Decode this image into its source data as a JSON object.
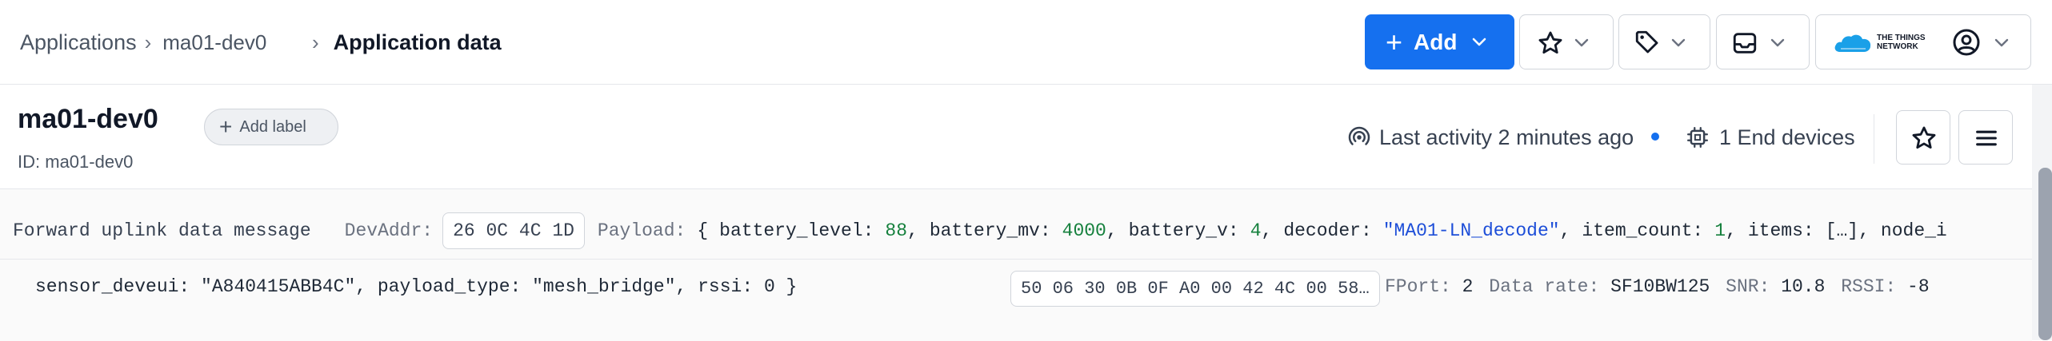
{
  "breadcrumb": {
    "root": "Applications",
    "app": "ma01-dev0",
    "current": "Application data"
  },
  "header": {
    "add_label": "Add",
    "brand_line1": "THE THINGS",
    "brand_line2": "NETWORK"
  },
  "app": {
    "name": "ma01-dev0",
    "id_label": "ID:",
    "id": "ma01-dev0",
    "add_label": "Add label",
    "last_activity": "Last activity 2 minutes ago",
    "end_devices": "1 End devices"
  },
  "event": {
    "type": "Forward uplink data message",
    "devaddr_key": "DevAddr:",
    "devaddr": "26 0C 4C 1D",
    "payload_key": "Payload:",
    "payload_open": "{",
    "battery_level_key": "battery_level:",
    "battery_level": "88",
    "battery_mv_key": "battery_mv:",
    "battery_mv": "4000",
    "battery_v_key": "battery_v:",
    "battery_v": "4",
    "decoder_key": "decoder:",
    "decoder": "\"MA01-LN_decode\"",
    "item_count_key": "item_count:",
    "item_count": "1",
    "items_key": "items:",
    "items": "[…]",
    "node_key": "node_i",
    "continuation": "sensor_deveui: \"A840415ABB4C\", payload_type: \"mesh_bridge\", rssi: 0 }",
    "raw_payload": "50 06 30 0B 0F A0 00 42 4C 00 58…",
    "fport_key": "FPort:",
    "fport": "2",
    "datarate_key": "Data rate:",
    "datarate": "SF10BW125",
    "snr_key": "SNR:",
    "snr": "10.8",
    "rssi_key": "RSSI:",
    "rssi": "-8"
  },
  "colors": {
    "primary": "#1570ef",
    "number": "#15803d",
    "string": "#1d4ed8",
    "brand_cloud": "#1aa0e8"
  }
}
